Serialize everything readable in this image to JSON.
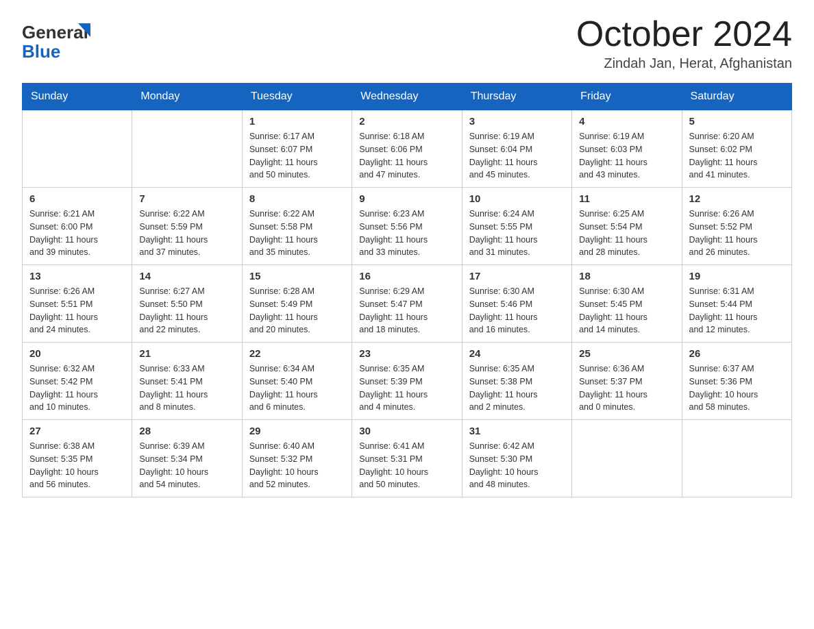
{
  "header": {
    "logo_general": "General",
    "logo_blue": "Blue",
    "month_title": "October 2024",
    "location": "Zindah Jan, Herat, Afghanistan"
  },
  "columns": [
    "Sunday",
    "Monday",
    "Tuesday",
    "Wednesday",
    "Thursday",
    "Friday",
    "Saturday"
  ],
  "weeks": [
    [
      {
        "day": "",
        "info": ""
      },
      {
        "day": "",
        "info": ""
      },
      {
        "day": "1",
        "info": "Sunrise: 6:17 AM\nSunset: 6:07 PM\nDaylight: 11 hours\nand 50 minutes."
      },
      {
        "day": "2",
        "info": "Sunrise: 6:18 AM\nSunset: 6:06 PM\nDaylight: 11 hours\nand 47 minutes."
      },
      {
        "day": "3",
        "info": "Sunrise: 6:19 AM\nSunset: 6:04 PM\nDaylight: 11 hours\nand 45 minutes."
      },
      {
        "day": "4",
        "info": "Sunrise: 6:19 AM\nSunset: 6:03 PM\nDaylight: 11 hours\nand 43 minutes."
      },
      {
        "day": "5",
        "info": "Sunrise: 6:20 AM\nSunset: 6:02 PM\nDaylight: 11 hours\nand 41 minutes."
      }
    ],
    [
      {
        "day": "6",
        "info": "Sunrise: 6:21 AM\nSunset: 6:00 PM\nDaylight: 11 hours\nand 39 minutes."
      },
      {
        "day": "7",
        "info": "Sunrise: 6:22 AM\nSunset: 5:59 PM\nDaylight: 11 hours\nand 37 minutes."
      },
      {
        "day": "8",
        "info": "Sunrise: 6:22 AM\nSunset: 5:58 PM\nDaylight: 11 hours\nand 35 minutes."
      },
      {
        "day": "9",
        "info": "Sunrise: 6:23 AM\nSunset: 5:56 PM\nDaylight: 11 hours\nand 33 minutes."
      },
      {
        "day": "10",
        "info": "Sunrise: 6:24 AM\nSunset: 5:55 PM\nDaylight: 11 hours\nand 31 minutes."
      },
      {
        "day": "11",
        "info": "Sunrise: 6:25 AM\nSunset: 5:54 PM\nDaylight: 11 hours\nand 28 minutes."
      },
      {
        "day": "12",
        "info": "Sunrise: 6:26 AM\nSunset: 5:52 PM\nDaylight: 11 hours\nand 26 minutes."
      }
    ],
    [
      {
        "day": "13",
        "info": "Sunrise: 6:26 AM\nSunset: 5:51 PM\nDaylight: 11 hours\nand 24 minutes."
      },
      {
        "day": "14",
        "info": "Sunrise: 6:27 AM\nSunset: 5:50 PM\nDaylight: 11 hours\nand 22 minutes."
      },
      {
        "day": "15",
        "info": "Sunrise: 6:28 AM\nSunset: 5:49 PM\nDaylight: 11 hours\nand 20 minutes."
      },
      {
        "day": "16",
        "info": "Sunrise: 6:29 AM\nSunset: 5:47 PM\nDaylight: 11 hours\nand 18 minutes."
      },
      {
        "day": "17",
        "info": "Sunrise: 6:30 AM\nSunset: 5:46 PM\nDaylight: 11 hours\nand 16 minutes."
      },
      {
        "day": "18",
        "info": "Sunrise: 6:30 AM\nSunset: 5:45 PM\nDaylight: 11 hours\nand 14 minutes."
      },
      {
        "day": "19",
        "info": "Sunrise: 6:31 AM\nSunset: 5:44 PM\nDaylight: 11 hours\nand 12 minutes."
      }
    ],
    [
      {
        "day": "20",
        "info": "Sunrise: 6:32 AM\nSunset: 5:42 PM\nDaylight: 11 hours\nand 10 minutes."
      },
      {
        "day": "21",
        "info": "Sunrise: 6:33 AM\nSunset: 5:41 PM\nDaylight: 11 hours\nand 8 minutes."
      },
      {
        "day": "22",
        "info": "Sunrise: 6:34 AM\nSunset: 5:40 PM\nDaylight: 11 hours\nand 6 minutes."
      },
      {
        "day": "23",
        "info": "Sunrise: 6:35 AM\nSunset: 5:39 PM\nDaylight: 11 hours\nand 4 minutes."
      },
      {
        "day": "24",
        "info": "Sunrise: 6:35 AM\nSunset: 5:38 PM\nDaylight: 11 hours\nand 2 minutes."
      },
      {
        "day": "25",
        "info": "Sunrise: 6:36 AM\nSunset: 5:37 PM\nDaylight: 11 hours\nand 0 minutes."
      },
      {
        "day": "26",
        "info": "Sunrise: 6:37 AM\nSunset: 5:36 PM\nDaylight: 10 hours\nand 58 minutes."
      }
    ],
    [
      {
        "day": "27",
        "info": "Sunrise: 6:38 AM\nSunset: 5:35 PM\nDaylight: 10 hours\nand 56 minutes."
      },
      {
        "day": "28",
        "info": "Sunrise: 6:39 AM\nSunset: 5:34 PM\nDaylight: 10 hours\nand 54 minutes."
      },
      {
        "day": "29",
        "info": "Sunrise: 6:40 AM\nSunset: 5:32 PM\nDaylight: 10 hours\nand 52 minutes."
      },
      {
        "day": "30",
        "info": "Sunrise: 6:41 AM\nSunset: 5:31 PM\nDaylight: 10 hours\nand 50 minutes."
      },
      {
        "day": "31",
        "info": "Sunrise: 6:42 AM\nSunset: 5:30 PM\nDaylight: 10 hours\nand 48 minutes."
      },
      {
        "day": "",
        "info": ""
      },
      {
        "day": "",
        "info": ""
      }
    ]
  ]
}
